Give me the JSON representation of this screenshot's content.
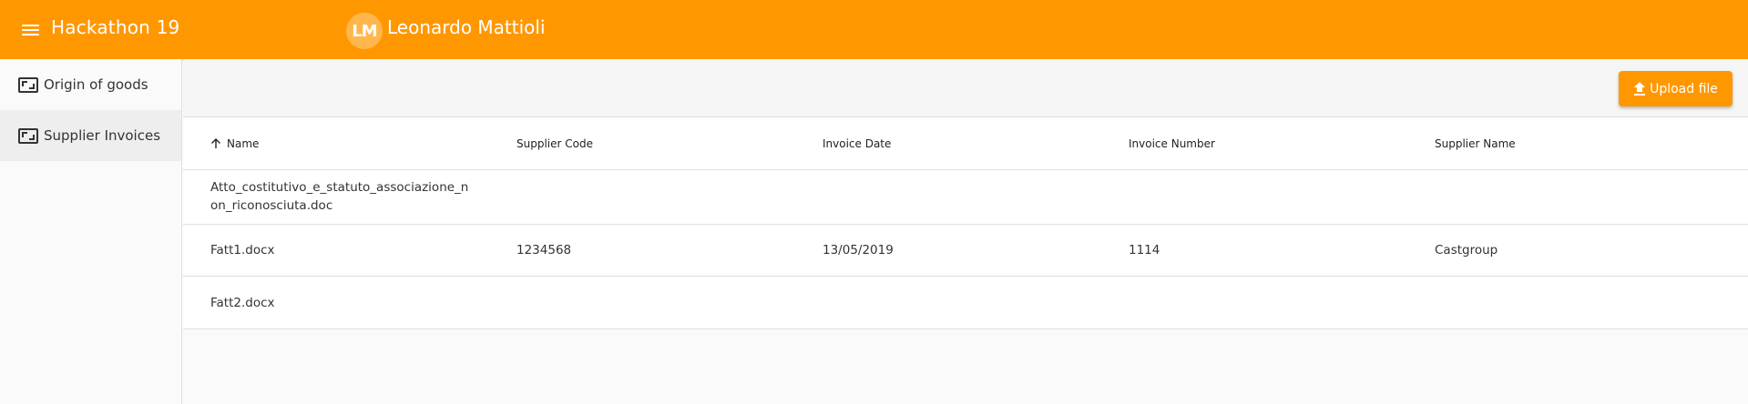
{
  "app": {
    "title": "Hackathon 19",
    "user_initials": "LM",
    "user_name": "Leonardo Mattioli"
  },
  "sidebar": {
    "items": [
      {
        "label": "Origin of goods",
        "icon": "image-frame-icon"
      },
      {
        "label": "Supplier Invoices",
        "icon": "image-frame-icon",
        "active": true
      }
    ]
  },
  "toolbar": {
    "upload_label": "Upload file"
  },
  "table": {
    "columns": [
      "Name",
      "Supplier Code",
      "Invoice Date",
      "Invoice Number",
      "Supplier Name"
    ],
    "sort_column": "Name",
    "rows": [
      [
        "Atto_costitutivo_e_statuto_associazione_non_riconosciuta.doc",
        "",
        "",
        "",
        ""
      ],
      [
        "Fatt1.docx",
        "1234568",
        "13/05/2019",
        "1114",
        "Castgroup"
      ],
      [
        "Fatt2.docx",
        "",
        "",
        "",
        ""
      ]
    ]
  },
  "colors": {
    "primary": "#ff9800",
    "avatar_bg": "#ffb74d",
    "active_nav_bg": "#eeeeee"
  }
}
